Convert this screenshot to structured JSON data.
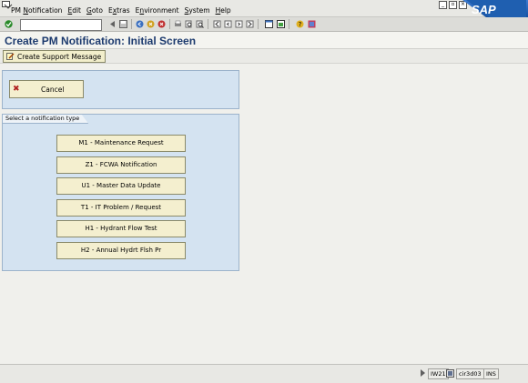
{
  "menu": {
    "items": [
      {
        "label": "PM Notification",
        "ul": "N",
        "pre": "PM ",
        "post": "otification"
      },
      {
        "label": "Edit",
        "ul": "E",
        "pre": "",
        "post": "dit"
      },
      {
        "label": "Goto",
        "ul": "G",
        "pre": "",
        "post": "oto"
      },
      {
        "label": "Extras",
        "ul": "x",
        "pre": "E",
        "post": "tras"
      },
      {
        "label": "Environment",
        "ul": "n",
        "pre": "E",
        "post": "vironment"
      },
      {
        "label": "System",
        "ul": "S",
        "pre": "",
        "post": "ystem"
      },
      {
        "label": "Help",
        "ul": "H",
        "pre": "",
        "post": "elp"
      }
    ]
  },
  "logo": "SAP",
  "command_field": {
    "value": ""
  },
  "title": "Create PM Notification: Initial Screen",
  "app_toolbar": {
    "support_label": "Create Support Message"
  },
  "cancel": {
    "label": "Cancel"
  },
  "notification_group": {
    "title": "Select a notification type",
    "types": [
      "M1 - Maintenance Request",
      "Z1 - FCWA Notification",
      "U1 - Master Data Update",
      "T1 - IT Problem / Request",
      "H1 - Hydrant Flow Test",
      "H2 - Annual Hydrt Flsh Pr"
    ]
  },
  "status": {
    "transaction": "IW21",
    "server": "cir3d03",
    "mode": "INS"
  },
  "colors": {
    "panel": "#d4e3f1",
    "button": "#f4efcf",
    "title": "#1c3a6e",
    "logo": "#1f5fb0"
  }
}
